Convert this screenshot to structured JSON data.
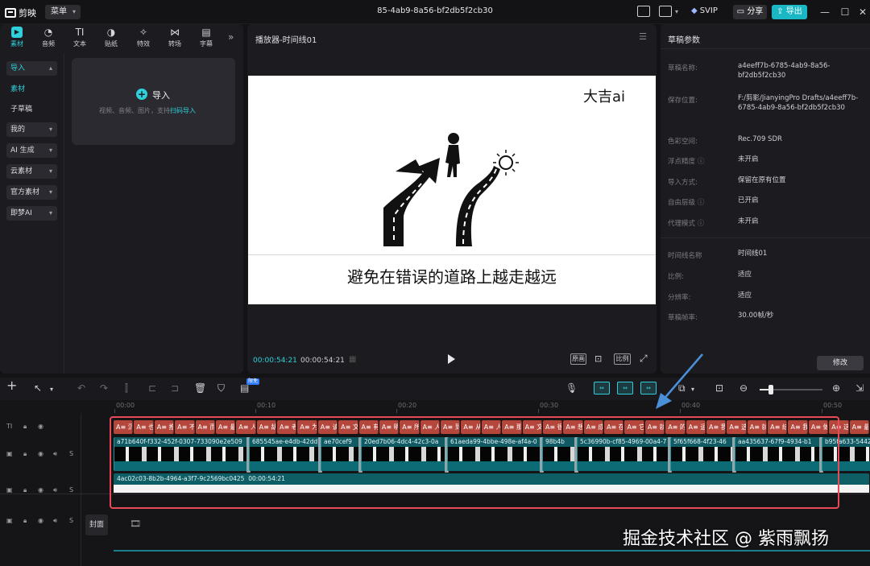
{
  "titlebar": {
    "app_name": "剪映",
    "menu_label": "菜单",
    "project_title": "85-4ab9-8a56-bf2db5f2cb30",
    "svip_label": "SVIP",
    "share_label": "分享",
    "export_label": "导出"
  },
  "media_panel": {
    "tabs": [
      {
        "label": "素材",
        "icon": "media-icon"
      },
      {
        "label": "音频",
        "icon": "audio-icon"
      },
      {
        "label": "文本",
        "icon": "text-icon"
      },
      {
        "label": "贴纸",
        "icon": "sticker-icon"
      },
      {
        "label": "特效",
        "icon": "effects-icon"
      },
      {
        "label": "转场",
        "icon": "transition-icon"
      },
      {
        "label": "字幕",
        "icon": "subtitle-icon"
      }
    ],
    "sidebar": {
      "import_group": "导入",
      "sub_material": "素材",
      "sub_draft": "子草稿",
      "mine": "我的",
      "ai_generate": "AI 生成",
      "cloud": "云素材",
      "official": "官方素材",
      "jimeng": "即梦AI"
    },
    "import_label": "导入",
    "import_hint": "视频、音频、图片，支持",
    "import_hint_link": "扫码导入"
  },
  "player": {
    "title": "播放器-时间线01",
    "brand_text": "大吉ai",
    "caption": "避免在错误的道路上越走越远",
    "time_current": "00:00:54:21",
    "time_total": "00:00:54:21",
    "btn_original": "原画",
    "btn_ratio": "比例"
  },
  "params": {
    "title": "草稿参数",
    "rows": [
      {
        "label": "草稿名称:",
        "value": "a4eeff7b-6785-4ab9-8a56-bf2db5f2cb30"
      },
      {
        "label": "保存位置:",
        "value": "F:/剪影/JianyingPro Drafts/a4eeff7b-6785-4ab9-8a56-bf2db5f2cb30"
      },
      {
        "label": "色彩空间:",
        "value": "Rec.709 SDR"
      },
      {
        "label": "浮点精度",
        "value": "未开启"
      },
      {
        "label": "导入方式:",
        "value": "保留在原有位置"
      },
      {
        "label": "自由层级",
        "value": "已开启"
      },
      {
        "label": "代理模式",
        "value": "未开启"
      },
      {
        "label": "时间线名称",
        "value": "时间线01"
      },
      {
        "label": "比例:",
        "value": "适应"
      },
      {
        "label": "分辨率:",
        "value": "适应"
      },
      {
        "label": "草稿帧率:",
        "value": "30.00帧/秒"
      }
    ],
    "modify_label": "修改"
  },
  "toolbar": {
    "free_badge": "限免"
  },
  "timeline": {
    "ruler": [
      "00:00",
      "00:10",
      "00:20",
      "00:30",
      "00:40",
      "00:50"
    ],
    "text_clips": [
      "沉醉",
      "也叫",
      "推入",
      "不仅",
      "而且",
      "最终",
      "人们",
      "胡逊",
      "老",
      "为",
      "读",
      "文",
      "有",
      "明",
      "所以",
      "人",
      "到",
      "从此",
      "人们",
      "那些",
      "文",
      "很",
      "想",
      "成功",
      "在",
      "它",
      "就",
      "的",
      "运动",
      "我的",
      "选",
      "就",
      "结合",
      "我们",
      "做法",
      "这",
      "最"
    ],
    "video_clips": [
      "a71b640f-f332-452f-0307-733090e2e509",
      "685545ae-e4db-42dd",
      "ae70cef9",
      "20ed7b06-4dc4-42c3-0a",
      "61aeda99-4bbe-498e-af4a-0",
      "98b4b",
      "5c36990b-cf85-4969-00a4-7",
      "5f65f668-4f23-46",
      "aa435637-67f9-4934-b1",
      "b95fa633-5442"
    ],
    "audio_clip": "4ac02c03-8b2b-4964-a3f7-9c2569bc0425",
    "audio_duration": "00:00:54:21",
    "cover_label": "封面"
  },
  "watermark": "掘金技术社区 @ 紫雨飘扬",
  "colors": {
    "accent": "#2fd0dc",
    "text_clip": "#b4463c",
    "video_clip": "#0f5a63",
    "highlight": "#e84a57"
  }
}
